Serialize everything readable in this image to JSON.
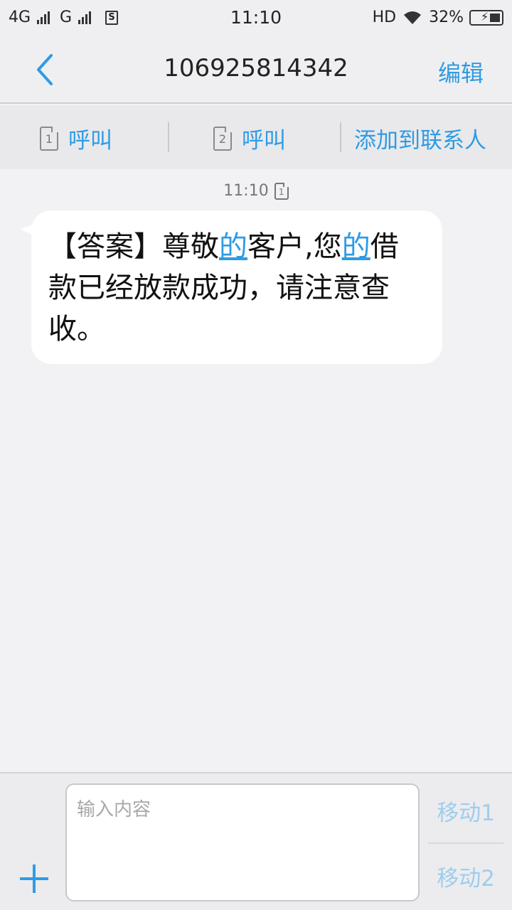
{
  "status_bar": {
    "network1": "4G",
    "network2": "G",
    "time": "11:10",
    "hd": "HD",
    "battery_percent": "32%"
  },
  "header": {
    "title": "106925814342",
    "edit_label": "编辑"
  },
  "actions": {
    "call_sim1_label": "呼叫",
    "call_sim2_label": "呼叫",
    "add_contact_label": "添加到联系人",
    "sim1": "1",
    "sim2": "2"
  },
  "messages": [
    {
      "time": "11:10",
      "sim": "1",
      "parts": [
        "【答案】尊敬",
        "的",
        "客户,您",
        "的",
        "借款已经放款成功，请注意查收。"
      ]
    }
  ],
  "composer": {
    "placeholder": "输入内容",
    "send_sim1_label": "移动1",
    "send_sim2_label": "移动2"
  },
  "colors": {
    "accent": "#2f9be4",
    "send_disabled": "#9fcdee",
    "background": "#f2f2f4",
    "bubble": "#ffffff"
  }
}
